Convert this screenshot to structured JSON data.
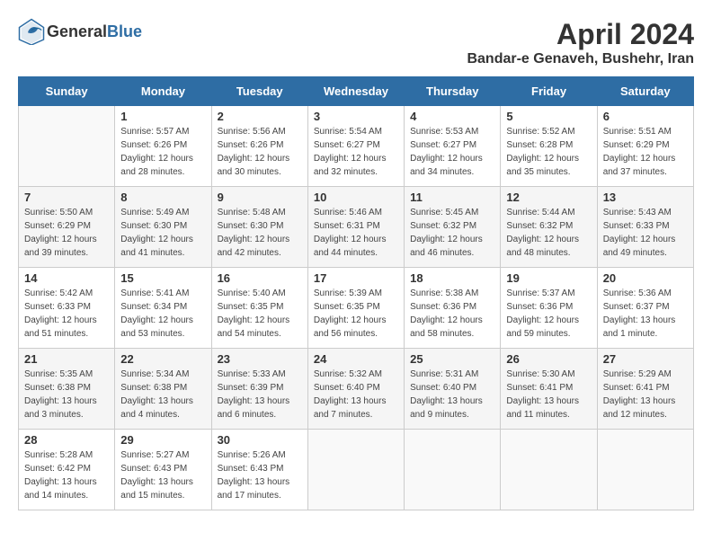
{
  "header": {
    "logo_general": "General",
    "logo_blue": "Blue",
    "month_title": "April 2024",
    "location": "Bandar-e Genaveh, Bushehr, Iran"
  },
  "columns": [
    "Sunday",
    "Monday",
    "Tuesday",
    "Wednesday",
    "Thursday",
    "Friday",
    "Saturday"
  ],
  "weeks": [
    [
      {
        "day": "",
        "sunrise": "",
        "sunset": "",
        "daylight": ""
      },
      {
        "day": "1",
        "sunrise": "Sunrise: 5:57 AM",
        "sunset": "Sunset: 6:26 PM",
        "daylight": "Daylight: 12 hours and 28 minutes."
      },
      {
        "day": "2",
        "sunrise": "Sunrise: 5:56 AM",
        "sunset": "Sunset: 6:26 PM",
        "daylight": "Daylight: 12 hours and 30 minutes."
      },
      {
        "day": "3",
        "sunrise": "Sunrise: 5:54 AM",
        "sunset": "Sunset: 6:27 PM",
        "daylight": "Daylight: 12 hours and 32 minutes."
      },
      {
        "day": "4",
        "sunrise": "Sunrise: 5:53 AM",
        "sunset": "Sunset: 6:27 PM",
        "daylight": "Daylight: 12 hours and 34 minutes."
      },
      {
        "day": "5",
        "sunrise": "Sunrise: 5:52 AM",
        "sunset": "Sunset: 6:28 PM",
        "daylight": "Daylight: 12 hours and 35 minutes."
      },
      {
        "day": "6",
        "sunrise": "Sunrise: 5:51 AM",
        "sunset": "Sunset: 6:29 PM",
        "daylight": "Daylight: 12 hours and 37 minutes."
      }
    ],
    [
      {
        "day": "7",
        "sunrise": "Sunrise: 5:50 AM",
        "sunset": "Sunset: 6:29 PM",
        "daylight": "Daylight: 12 hours and 39 minutes."
      },
      {
        "day": "8",
        "sunrise": "Sunrise: 5:49 AM",
        "sunset": "Sunset: 6:30 PM",
        "daylight": "Daylight: 12 hours and 41 minutes."
      },
      {
        "day": "9",
        "sunrise": "Sunrise: 5:48 AM",
        "sunset": "Sunset: 6:30 PM",
        "daylight": "Daylight: 12 hours and 42 minutes."
      },
      {
        "day": "10",
        "sunrise": "Sunrise: 5:46 AM",
        "sunset": "Sunset: 6:31 PM",
        "daylight": "Daylight: 12 hours and 44 minutes."
      },
      {
        "day": "11",
        "sunrise": "Sunrise: 5:45 AM",
        "sunset": "Sunset: 6:32 PM",
        "daylight": "Daylight: 12 hours and 46 minutes."
      },
      {
        "day": "12",
        "sunrise": "Sunrise: 5:44 AM",
        "sunset": "Sunset: 6:32 PM",
        "daylight": "Daylight: 12 hours and 48 minutes."
      },
      {
        "day": "13",
        "sunrise": "Sunrise: 5:43 AM",
        "sunset": "Sunset: 6:33 PM",
        "daylight": "Daylight: 12 hours and 49 minutes."
      }
    ],
    [
      {
        "day": "14",
        "sunrise": "Sunrise: 5:42 AM",
        "sunset": "Sunset: 6:33 PM",
        "daylight": "Daylight: 12 hours and 51 minutes."
      },
      {
        "day": "15",
        "sunrise": "Sunrise: 5:41 AM",
        "sunset": "Sunset: 6:34 PM",
        "daylight": "Daylight: 12 hours and 53 minutes."
      },
      {
        "day": "16",
        "sunrise": "Sunrise: 5:40 AM",
        "sunset": "Sunset: 6:35 PM",
        "daylight": "Daylight: 12 hours and 54 minutes."
      },
      {
        "day": "17",
        "sunrise": "Sunrise: 5:39 AM",
        "sunset": "Sunset: 6:35 PM",
        "daylight": "Daylight: 12 hours and 56 minutes."
      },
      {
        "day": "18",
        "sunrise": "Sunrise: 5:38 AM",
        "sunset": "Sunset: 6:36 PM",
        "daylight": "Daylight: 12 hours and 58 minutes."
      },
      {
        "day": "19",
        "sunrise": "Sunrise: 5:37 AM",
        "sunset": "Sunset: 6:36 PM",
        "daylight": "Daylight: 12 hours and 59 minutes."
      },
      {
        "day": "20",
        "sunrise": "Sunrise: 5:36 AM",
        "sunset": "Sunset: 6:37 PM",
        "daylight": "Daylight: 13 hours and 1 minute."
      }
    ],
    [
      {
        "day": "21",
        "sunrise": "Sunrise: 5:35 AM",
        "sunset": "Sunset: 6:38 PM",
        "daylight": "Daylight: 13 hours and 3 minutes."
      },
      {
        "day": "22",
        "sunrise": "Sunrise: 5:34 AM",
        "sunset": "Sunset: 6:38 PM",
        "daylight": "Daylight: 13 hours and 4 minutes."
      },
      {
        "day": "23",
        "sunrise": "Sunrise: 5:33 AM",
        "sunset": "Sunset: 6:39 PM",
        "daylight": "Daylight: 13 hours and 6 minutes."
      },
      {
        "day": "24",
        "sunrise": "Sunrise: 5:32 AM",
        "sunset": "Sunset: 6:40 PM",
        "daylight": "Daylight: 13 hours and 7 minutes."
      },
      {
        "day": "25",
        "sunrise": "Sunrise: 5:31 AM",
        "sunset": "Sunset: 6:40 PM",
        "daylight": "Daylight: 13 hours and 9 minutes."
      },
      {
        "day": "26",
        "sunrise": "Sunrise: 5:30 AM",
        "sunset": "Sunset: 6:41 PM",
        "daylight": "Daylight: 13 hours and 11 minutes."
      },
      {
        "day": "27",
        "sunrise": "Sunrise: 5:29 AM",
        "sunset": "Sunset: 6:41 PM",
        "daylight": "Daylight: 13 hours and 12 minutes."
      }
    ],
    [
      {
        "day": "28",
        "sunrise": "Sunrise: 5:28 AM",
        "sunset": "Sunset: 6:42 PM",
        "daylight": "Daylight: 13 hours and 14 minutes."
      },
      {
        "day": "29",
        "sunrise": "Sunrise: 5:27 AM",
        "sunset": "Sunset: 6:43 PM",
        "daylight": "Daylight: 13 hours and 15 minutes."
      },
      {
        "day": "30",
        "sunrise": "Sunrise: 5:26 AM",
        "sunset": "Sunset: 6:43 PM",
        "daylight": "Daylight: 13 hours and 17 minutes."
      },
      {
        "day": "",
        "sunrise": "",
        "sunset": "",
        "daylight": ""
      },
      {
        "day": "",
        "sunrise": "",
        "sunset": "",
        "daylight": ""
      },
      {
        "day": "",
        "sunrise": "",
        "sunset": "",
        "daylight": ""
      },
      {
        "day": "",
        "sunrise": "",
        "sunset": "",
        "daylight": ""
      }
    ]
  ]
}
